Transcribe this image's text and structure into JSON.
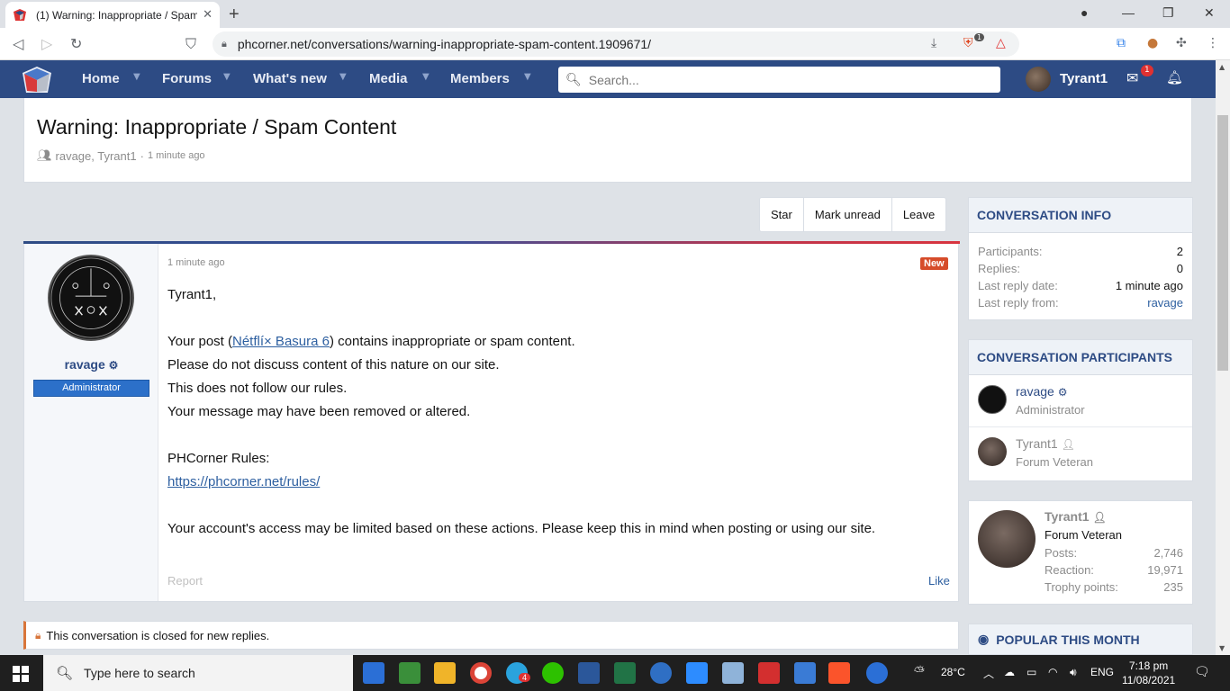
{
  "browser": {
    "tab_title": "(1) Warning: Inappropriate / Spam",
    "url": "phcorner.net/conversations/warning-inappropriate-spam-content.1909671/",
    "ext_badge": "1"
  },
  "nav": {
    "items": [
      "Home",
      "Forums",
      "What's new",
      "Media",
      "Members"
    ],
    "search_placeholder": "Search...",
    "username": "Tyrant1",
    "mail_badge": "1"
  },
  "conversation": {
    "title": "Warning: Inappropriate / Spam Content",
    "participants_text": "ravage, Tyrant1",
    "time": "1 minute ago",
    "actions": [
      "Star",
      "Mark unread",
      "Leave"
    ]
  },
  "message": {
    "author": "ravage",
    "role": "Administrator",
    "time": "1 minute ago",
    "badge": "New",
    "greeting": "Tyrant1,",
    "line1_pre": "Your post (",
    "line1_link": "Nétflí× Basura 6",
    "line1_post": ") contains inappropriate or spam content.",
    "line2": "Please do not discuss content of this nature on our site.",
    "line3": "This does not follow our rules.",
    "line4": "Your message may have been removed or altered.",
    "rules_label": "PHCorner Rules:",
    "rules_link": "https://phcorner.net/rules/",
    "closing": "Your account's access may be limited based on these actions. Please keep this in mind when posting or using our site.",
    "report": "Report",
    "like": "Like"
  },
  "closed_notice": "This conversation is closed for new replies.",
  "sidebar": {
    "info_title": "CONVERSATION INFO",
    "info": [
      {
        "k": "Participants:",
        "v": "2"
      },
      {
        "k": "Replies:",
        "v": "0"
      },
      {
        "k": "Last reply date:",
        "v": "1 minute ago"
      },
      {
        "k": "Last reply from:",
        "v": "ravage"
      }
    ],
    "participants_title": "CONVERSATION PARTICIPANTS",
    "participants": [
      {
        "name": "ravage",
        "role": "Administrator"
      },
      {
        "name": "Tyrant1",
        "role": "Forum Veteran"
      }
    ],
    "profile": {
      "name": "Tyrant1",
      "title": "Forum Veteran",
      "stats": [
        {
          "k": "Posts:",
          "v": "2,746"
        },
        {
          "k": "Reaction:",
          "v": "19,971"
        },
        {
          "k": "Trophy points:",
          "v": "235"
        }
      ]
    },
    "popular_title": "POPULAR THIS MONTH"
  },
  "taskbar": {
    "search_placeholder": "Type here to search",
    "weather": "28°C",
    "lang": "ENG",
    "time": "7:18 pm",
    "date": "11/08/2021",
    "telegram_badge": "4"
  }
}
